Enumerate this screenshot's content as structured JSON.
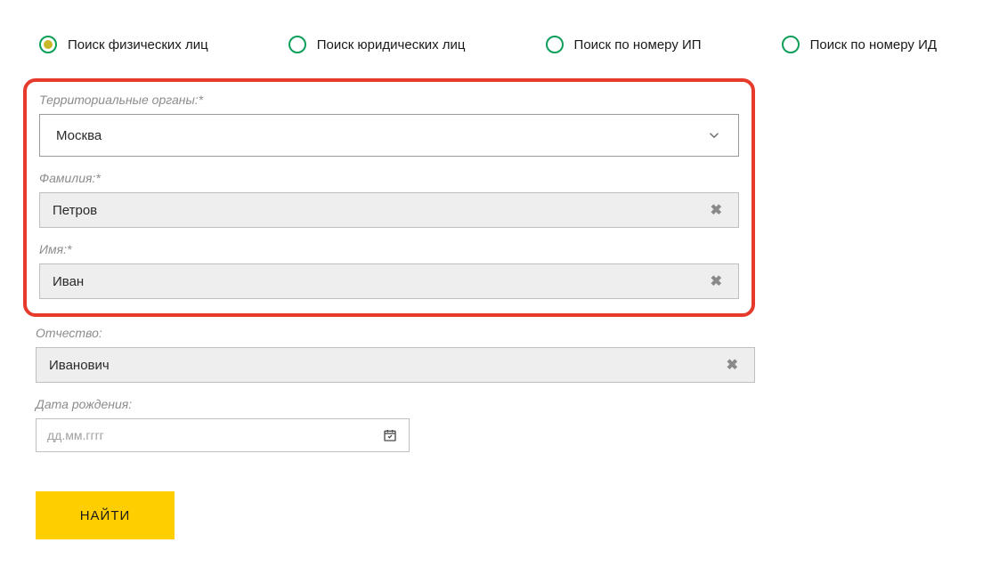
{
  "radios": {
    "individuals": "Поиск физических лиц",
    "legal": "Поиск юридических лиц",
    "ip_number": "Поиск по номеру ИП",
    "id_number": "Поиск по номеру ИД"
  },
  "fields": {
    "region": {
      "label": "Территориальные органы:*",
      "value": "Москва"
    },
    "surname": {
      "label": "Фамилия:*",
      "value": "Петров"
    },
    "name": {
      "label": "Имя:*",
      "value": "Иван"
    },
    "patronymic": {
      "label": "Отчество:",
      "value": "Иванович"
    },
    "dob": {
      "label": "Дата рождения:",
      "placeholder": "дд.мм.гггг"
    }
  },
  "submit": "НАЙТИ"
}
